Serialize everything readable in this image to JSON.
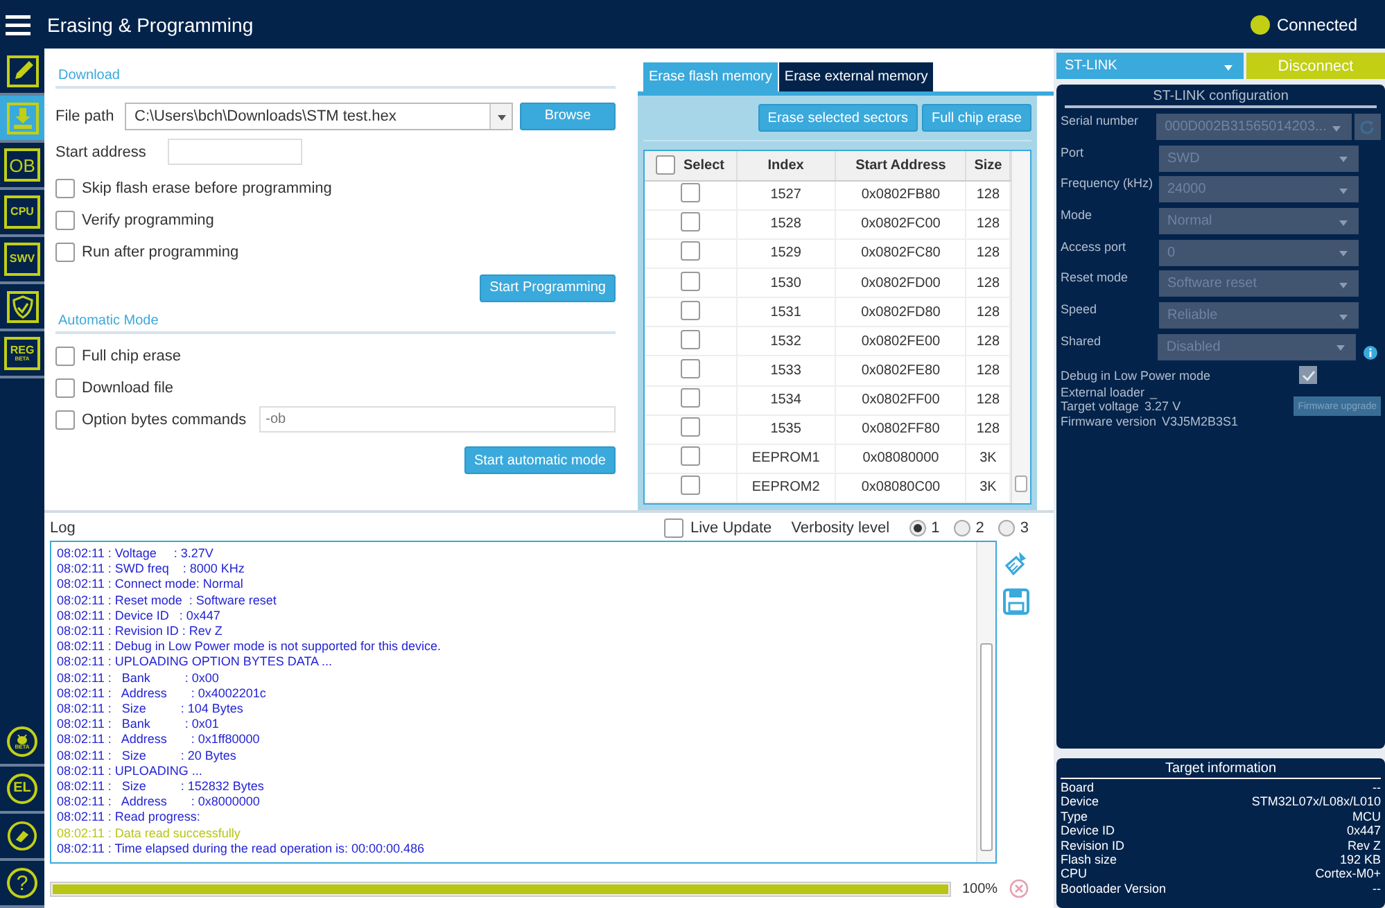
{
  "header": {
    "title": "Erasing & Programming",
    "connection": {
      "label": "Connected",
      "on": true
    }
  },
  "sidebar": {
    "top": [
      {
        "kind": "pencil",
        "selected": false
      },
      {
        "kind": "download",
        "selected": true
      },
      {
        "kind": "text",
        "label": "OB",
        "selected": false
      },
      {
        "kind": "text",
        "label": "CPU",
        "selected": false
      },
      {
        "kind": "text",
        "label": "SWV",
        "selected": false
      },
      {
        "kind": "shield",
        "selected": false
      },
      {
        "kind": "text",
        "label": "REG",
        "sub": "BETA",
        "selected": false
      }
    ],
    "bottom": [
      {
        "kind": "bug",
        "sub": "BETA"
      },
      {
        "kind": "circle",
        "label": "EL"
      },
      {
        "kind": "eraser"
      },
      {
        "kind": "circle",
        "label": "?"
      }
    ]
  },
  "download": {
    "title": "Download",
    "file_path": {
      "label": "File path",
      "value": "C:\\Users\\bch\\Downloads\\STM test.hex"
    },
    "browse": "Browse",
    "start_address": {
      "label": "Start address"
    },
    "options": [
      {
        "label": "Skip flash erase before programming",
        "checked": false
      },
      {
        "label": "Verify programming",
        "checked": false
      },
      {
        "label": "Run after programming",
        "checked": false
      }
    ],
    "button": "Start Programming"
  },
  "automatic": {
    "title": "Automatic Mode",
    "options": [
      {
        "label": "Full chip erase",
        "checked": false
      },
      {
        "label": "Download file",
        "checked": false
      },
      {
        "label": "Option bytes commands",
        "checked": false,
        "placeholder": "-ob"
      }
    ],
    "button": "Start automatic mode"
  },
  "erase": {
    "tabs": [
      {
        "label": "Erase flash memory",
        "selected": true
      },
      {
        "label": "Erase external memory",
        "selected": false
      }
    ],
    "buttons": [
      "Erase selected sectors",
      "Full chip erase"
    ],
    "table": {
      "select_all": false,
      "select_label": "Select",
      "columns": [
        "Index",
        "Start Address",
        "Size"
      ],
      "rows": [
        {
          "checked": false,
          "cells": [
            "1527",
            "0x0802FB80",
            "128"
          ]
        },
        {
          "checked": false,
          "cells": [
            "1528",
            "0x0802FC00",
            "128"
          ]
        },
        {
          "checked": false,
          "cells": [
            "1529",
            "0x0802FC80",
            "128"
          ]
        },
        {
          "checked": false,
          "cells": [
            "1530",
            "0x0802FD00",
            "128"
          ]
        },
        {
          "checked": false,
          "cells": [
            "1531",
            "0x0802FD80",
            "128"
          ]
        },
        {
          "checked": false,
          "cells": [
            "1532",
            "0x0802FE00",
            "128"
          ]
        },
        {
          "checked": false,
          "cells": [
            "1533",
            "0x0802FE80",
            "128"
          ]
        },
        {
          "checked": false,
          "cells": [
            "1534",
            "0x0802FF00",
            "128"
          ]
        },
        {
          "checked": false,
          "cells": [
            "1535",
            "0x0802FF80",
            "128"
          ]
        },
        {
          "checked": false,
          "cells": [
            "EEPROM1",
            "0x08080000",
            "3K"
          ]
        },
        {
          "checked": false,
          "cells": [
            "EEPROM2",
            "0x08080C00",
            "3K"
          ]
        }
      ]
    }
  },
  "log": {
    "title": "Log",
    "live_update": {
      "label": "Live Update",
      "checked": false
    },
    "verbosity": {
      "label": "Verbosity level",
      "options": [
        {
          "label": "1",
          "selected": true
        },
        {
          "label": "2",
          "selected": false
        },
        {
          "label": "3",
          "selected": false
        }
      ]
    },
    "lines": [
      {
        "kind": "info",
        "text": "08:02:11 : Voltage     : 3.27V"
      },
      {
        "kind": "info",
        "text": "08:02:11 : SWD freq    : 8000 KHz"
      },
      {
        "kind": "info",
        "text": "08:02:11 : Connect mode: Normal"
      },
      {
        "kind": "info",
        "text": "08:02:11 : Reset mode  : Software reset"
      },
      {
        "kind": "info",
        "text": "08:02:11 : Device ID   : 0x447"
      },
      {
        "kind": "info",
        "text": "08:02:11 : Revision ID : Rev Z"
      },
      {
        "kind": "info",
        "text": "08:02:11 : Debug in Low Power mode is not supported for this device."
      },
      {
        "kind": "info",
        "text": "08:02:11 : UPLOADING OPTION BYTES DATA ..."
      },
      {
        "kind": "info",
        "text": "08:02:11 :   Bank          : 0x00"
      },
      {
        "kind": "info",
        "text": "08:02:11 :   Address       : 0x4002201c"
      },
      {
        "kind": "info",
        "text": "08:02:11 :   Size          : 104 Bytes"
      },
      {
        "kind": "info",
        "text": "08:02:11 :   Bank          : 0x01"
      },
      {
        "kind": "info",
        "text": "08:02:11 :   Address       : 0x1ff80000"
      },
      {
        "kind": "info",
        "text": "08:02:11 :   Size          : 20 Bytes"
      },
      {
        "kind": "info",
        "text": "08:02:11 : UPLOADING ..."
      },
      {
        "kind": "info",
        "text": "08:02:11 :   Size          : 152832 Bytes"
      },
      {
        "kind": "info",
        "text": "08:02:11 :   Address       : 0x8000000"
      },
      {
        "kind": "info",
        "text": "08:02:11 : Read progress:"
      },
      {
        "kind": "success",
        "text": "08:02:11 : Data read successfully"
      },
      {
        "kind": "info",
        "text": "08:02:11 : Time elapsed during the read operation is: 00:00:00.486"
      }
    ],
    "progress": {
      "level": 1.0,
      "reading": "100%"
    }
  },
  "probe": {
    "selector": "ST-LINK",
    "disconnect": "Disconnect"
  },
  "config": {
    "title": "ST-LINK configuration",
    "fields": [
      {
        "label": "Serial number",
        "value": "000D002B31565014203...",
        "refresh": true
      },
      {
        "label": "Port",
        "value": "SWD"
      },
      {
        "label": "Frequency (kHz)",
        "value": "24000"
      },
      {
        "label": "Mode",
        "value": "Normal"
      },
      {
        "label": "Access port",
        "value": "0"
      },
      {
        "label": "Reset mode",
        "value": "Software reset"
      },
      {
        "label": "Speed",
        "value": "Reliable"
      },
      {
        "label": "Shared",
        "value": "Disabled",
        "info": true
      }
    ],
    "debug_low_power": {
      "label": "Debug in Low Power mode",
      "checked": true
    },
    "external_loader": {
      "label": "External loader",
      "value": "_"
    },
    "target_voltage": {
      "label": "Target voltage",
      "value": "3.27 V"
    },
    "firmware_version": {
      "label": "Firmware version",
      "value": "V3J5M2B3S1"
    },
    "firmware_upgrade": "Firmware upgrade"
  },
  "target": {
    "title": "Target information",
    "rows": [
      {
        "label": "Board",
        "value": "--"
      },
      {
        "label": "Device",
        "value": "STM32L07x/L08x/L010"
      },
      {
        "label": "Type",
        "value": "MCU"
      },
      {
        "label": "Device ID",
        "value": "0x447"
      },
      {
        "label": "Revision ID",
        "value": "Rev Z"
      },
      {
        "label": "Flash size",
        "value": "192 KB"
      },
      {
        "label": "CPU",
        "value": "Cortex-M0+"
      },
      {
        "label": "Bootloader Version",
        "value": "--"
      }
    ]
  }
}
